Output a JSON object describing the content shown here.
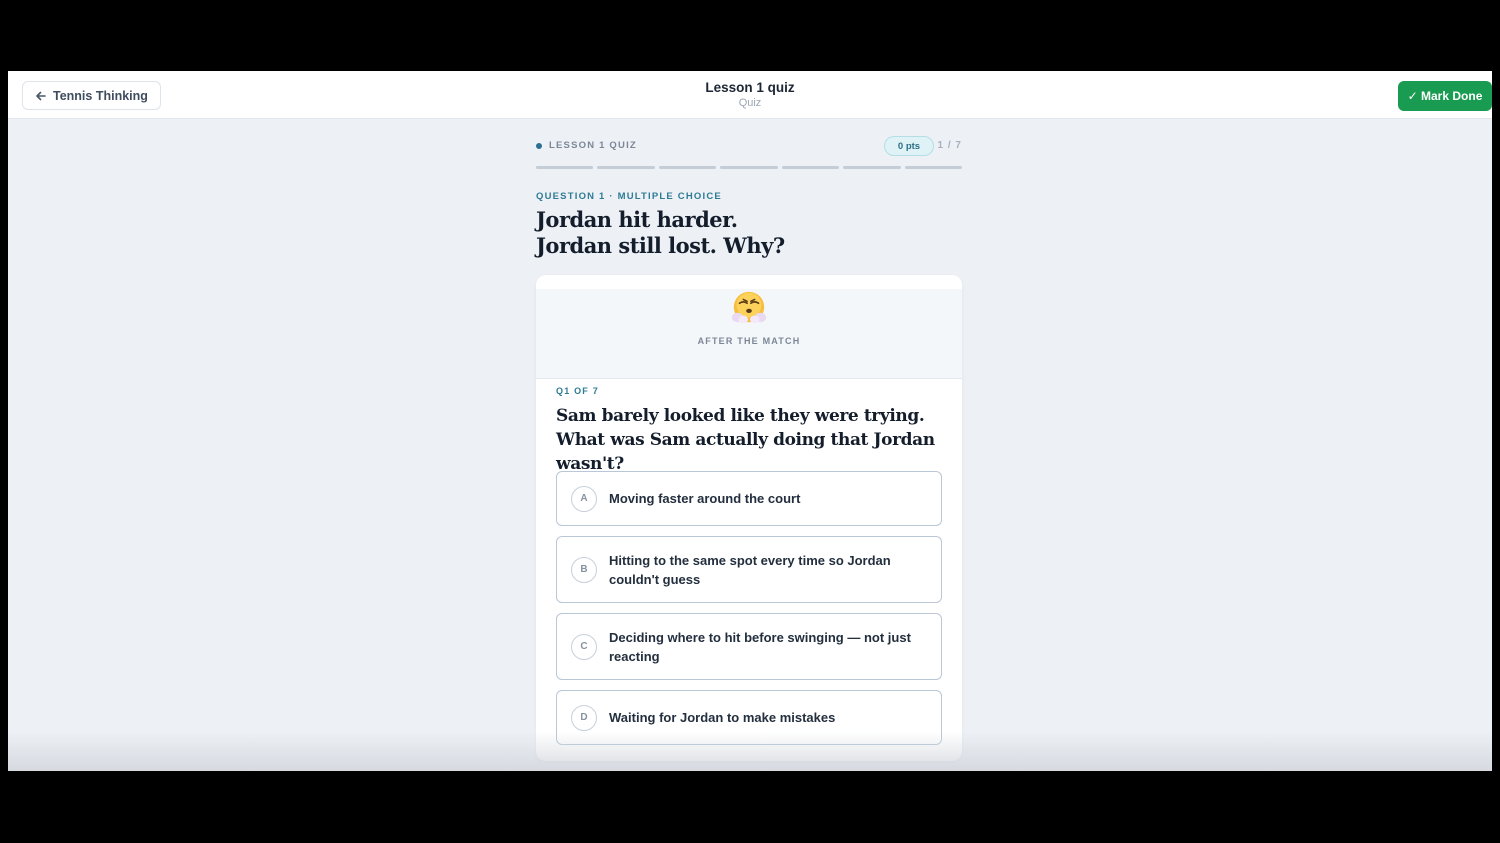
{
  "header": {
    "back_label": "Tennis Thinking",
    "title": "Lesson 1 quiz",
    "subtitle": "Quiz",
    "mark_done_label": "✓ Mark Done"
  },
  "quiz": {
    "section_label": "LESSON 1 QUIZ",
    "points": "0 pts",
    "counter": "1 / 7",
    "progress": {
      "current": 1,
      "total": 7
    },
    "question_type": "QUESTION 1 · MULTIPLE CHOICE",
    "headline": "Jordan hit harder.\nJordan still lost. Why?"
  },
  "card": {
    "emoji": "face-with-steam-emoji",
    "scene_label": "AFTER THE MATCH",
    "question_number": "Q1 OF 7",
    "question_text": "Sam barely looked like they were trying. What was Sam actually doing that Jordan wasn't?",
    "options": [
      {
        "letter": "A",
        "text": "Moving faster around the court"
      },
      {
        "letter": "B",
        "text": "Hitting to the same spot every time so Jordan couldn't guess"
      },
      {
        "letter": "C",
        "text": "Deciding where to hit before swinging — not just reacting"
      },
      {
        "letter": "D",
        "text": "Waiting for Jordan to make mistakes"
      }
    ]
  },
  "colors": {
    "accent": "#2e7b94",
    "success": "#1a9b52",
    "background": "#edf1f6"
  }
}
